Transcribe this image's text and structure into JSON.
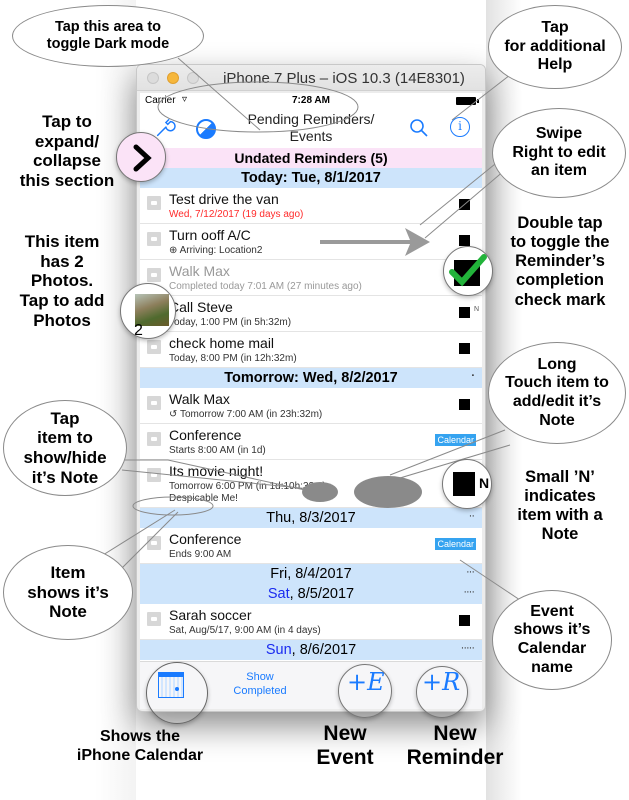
{
  "window": {
    "title": "iPhone 7 Plus – iOS 10.3 (14E8301)"
  },
  "statusbar": {
    "carrier": "Carrier",
    "wifi_icon": "▿",
    "time": "7:28 AM"
  },
  "navbar": {
    "title_line1": "Pending Reminders/",
    "title_line2": "Events",
    "info_glyph": "i",
    "icons": [
      "wrench-icon",
      "contrast-icon",
      "search-icon",
      "info-icon"
    ]
  },
  "sections": {
    "undated": "Undated Reminders (5)",
    "today": "Today: Tue, 8/1/2017",
    "tomorrow": "Tomorrow: Wed, 8/2/2017",
    "tomorrow_dots": "·",
    "thu": "Thu, 8/3/2017",
    "thu_dots": "··",
    "fri": "Fri, 8/4/2017",
    "fri_dots": "···",
    "sat_weekday": "Sat",
    "sat_rest": ", 8/5/2017",
    "sat_dots": "····",
    "sun_weekday": "Sun",
    "sun_rest": ", 8/6/2017",
    "sun_dots": "·····"
  },
  "rows": [
    {
      "title": "Test drive the van",
      "subtitle": "Wed, 7/12/2017  (19 days ago)",
      "overdue": true
    },
    {
      "title": "Turn ooff A/C",
      "subtitle": "⊕ Arriving: Location2"
    },
    {
      "title": "Walk Max",
      "subtitle": "Completed today 7:01 AM  (27 minutes ago)",
      "completed": true
    },
    {
      "title": "Call Steve",
      "subtitle": "Today, 1:00 PM  (in 5h:32m)",
      "note_flag": "N",
      "photos": 2
    },
    {
      "title": "check home mail",
      "subtitle": "Today, 8:00 PM  (in 12h:32m)"
    },
    {
      "title": "Walk Max",
      "subtitle": "↺ Tomorrow 7:00 AM  (in 23h:32m)"
    },
    {
      "title": "Conference",
      "subtitle": "Starts 8:00 AM (in 1d)",
      "calendar": "Calendar"
    },
    {
      "title": "Its movie night!",
      "subtitle": "Tomorrow 6:00 PM  (in 1d:10h:32m)",
      "note": "Despicable Me!",
      "note_flag": "N"
    },
    {
      "title": "Conference",
      "subtitle": "Ends 9:00 AM",
      "calendar": "Calendar"
    },
    {
      "title": "Sarah soccer",
      "subtitle": "Sat, Aug/5/17, 9:00 AM  (in 4 days)"
    }
  ],
  "toolbar": {
    "show_completed_line1": "Show",
    "show_completed_line2": "Completed",
    "new_event": "+E",
    "new_reminder": "+R"
  },
  "colors": {
    "accent": "#1a7bff",
    "overdue": "#ff2a2a",
    "undated_header": "#fbe3f7",
    "date_header": "#cde4fb",
    "calendar_badge": "#35a3f0",
    "weekend": "#1a2bf0",
    "check_green": "#22b33a"
  },
  "annotations": {
    "dark_mode": [
      "Tap this area to",
      "toggle Dark mode"
    ],
    "help": [
      "Tap",
      "for additional",
      "Help"
    ],
    "expand": [
      "Tap to",
      "expand/",
      "collapse",
      "this section"
    ],
    "swipe": [
      "Swipe",
      "Right to edit",
      "an item"
    ],
    "double_tap": [
      "Double tap",
      "to toggle the",
      "Reminder’s",
      "completion",
      "check mark"
    ],
    "photos": [
      "This item",
      "has 2",
      "Photos.",
      "Tap to add",
      "Photos"
    ],
    "photo_count": "2",
    "tap_note": [
      "Tap",
      "item to",
      "show/hide",
      "it’s Note"
    ],
    "long_touch": [
      "Long",
      "Touch item to",
      "add/edit it’s",
      "Note"
    ],
    "small_n": [
      "Small ’N’",
      "indicates",
      "item with a",
      "Note"
    ],
    "big_n": "N",
    "shows_note": [
      "Item",
      "shows it’s",
      "Note"
    ],
    "event_calendar": [
      "Event",
      "shows it’s",
      "Calendar",
      "name"
    ],
    "calendar": [
      "Shows the",
      "iPhone Calendar"
    ],
    "new_event": [
      "New",
      "Event"
    ],
    "new_reminder": [
      "New",
      "Reminder"
    ]
  }
}
